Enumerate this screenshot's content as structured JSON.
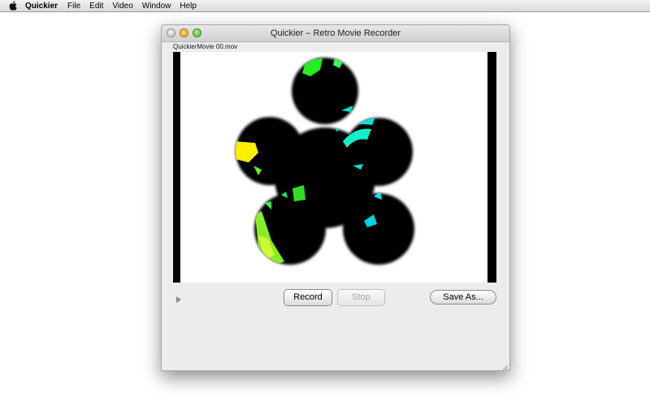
{
  "menubar": {
    "apple_icon": "apple-icon",
    "app_name": "Quickier",
    "items": [
      "File",
      "Edit",
      "Video",
      "Window",
      "Help"
    ]
  },
  "window": {
    "title": "Quickier – Retro Movie Recorder",
    "filename": "QuickierMovie 00.mov",
    "controls": {
      "play_icon": "play-triangle-icon",
      "record_label": "Record",
      "stop_label": "Stop",
      "stop_enabled": false,
      "save_label": "Save As..."
    }
  },
  "colors": {
    "preview_bg": "#000000",
    "accent_green": "#33ff33",
    "accent_cyan": "#00e5d4",
    "accent_yellow": "#ffee00"
  }
}
